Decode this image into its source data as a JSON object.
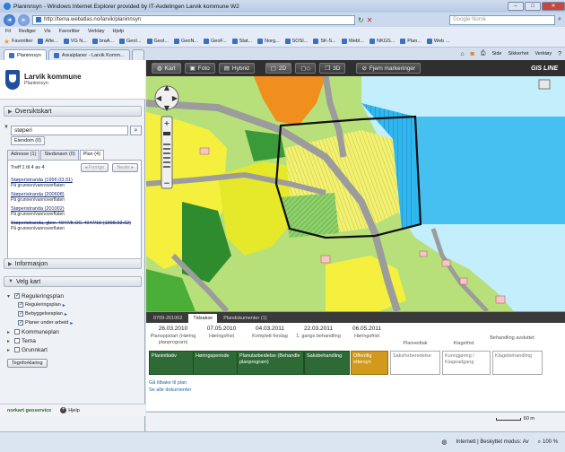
{
  "browser": {
    "title": "Planinnsyn - Windows Internet Explorer provided by IT-Avdelingen Larvik kommune W2",
    "url": "http://tema.webatlas.no/larvik/planinnsyn",
    "search_placeholder": "Google Norsk",
    "menu": [
      "Fil",
      "Rediger",
      "Vis",
      "Favoritter",
      "Verktøy",
      "Hjelp"
    ],
    "favorites_label": "Favoritter",
    "favorites": [
      "Afte...",
      "VG N...",
      "braA...",
      "GeoI...",
      "GeoI...",
      "GeoN...",
      "GeoF...",
      "Stat...",
      "Norg...",
      "SOSI...",
      "SK-S...",
      "WebI...",
      "NKGS...",
      "Plan...",
      "Web ..."
    ],
    "tabs": [
      {
        "label": "Planinnsyn",
        "active": true
      },
      {
        "label": "Arealplaner - Larvik Komm...",
        "active": false
      }
    ],
    "commands": [
      "Side",
      "Sikkerhet",
      "Verktøy"
    ],
    "status_zone": "Internett | Beskyttet modus: Av",
    "zoom": "100 %"
  },
  "app": {
    "name": "Larvik kommune",
    "subtitle": "Planinnsyn",
    "sections": {
      "overview": "Oversiktskart",
      "info": "Informasjon",
      "choose_map": "Velg kart"
    },
    "search": {
      "value": "støperi"
    },
    "owners_button": "Eiendom (0)",
    "result_tabs": [
      {
        "label": "Adresse (1)"
      },
      {
        "label": "Stedsnavn (0)"
      },
      {
        "label": "Plan (4)",
        "active": true
      }
    ],
    "paging": {
      "text": "Treff 1 til 4 av 4",
      "prev": "◂ Forrige",
      "next": "Neste ▸"
    },
    "results": [
      {
        "title": "Støperistranda (1996.03.01)",
        "sub": "På grunnen/vannoverflaten"
      },
      {
        "title": "Støperistranda (200608)",
        "sub": "På grunnen/vannoverflaten"
      },
      {
        "title": "Støperistranda (201002)",
        "sub": "På grunnen/vannoverflaten"
      },
      {
        "title": "Støperistranda, gbnr. 4047/5 OG 4047/10 (1998.03.02)",
        "sub": "På grunnen/vannoverflaten"
      }
    ],
    "layers": [
      {
        "label": "Reguleringsplan",
        "checked": true,
        "level": 0
      },
      {
        "label": "Reguleringsplan",
        "checked": true,
        "level": 1
      },
      {
        "label": "Bebyggelsesplan",
        "checked": true,
        "level": 1
      },
      {
        "label": "Planer under arbeid",
        "checked": true,
        "level": 1
      },
      {
        "label": "Kommuneplan",
        "checked": false,
        "level": 0
      },
      {
        "label": "Tema",
        "checked": false,
        "level": 0
      },
      {
        "label": "Grunnkart",
        "checked": false,
        "level": 0
      }
    ],
    "legend_button": "Tegnforklaring",
    "footer_logo": "norkart geoservice",
    "help": "Hjelp"
  },
  "map_toolbar": {
    "kart": "Kart",
    "foto": "Foto",
    "hybrid": "Hybrid",
    "d2": "2D",
    "d3": "3D",
    "clear": "Fjern markeringer",
    "brand": "GIS LINE"
  },
  "timeline": {
    "tabs": [
      "0709-201002",
      "Tidsakse",
      "Plandokumenter (1)"
    ],
    "events": [
      {
        "date": "26.03.2010",
        "label": "Planoppstart (Høring planprogram)"
      },
      {
        "date": "07.05.2010",
        "label": "Høringsfrist"
      },
      {
        "date": "04.03.2011",
        "label": "Komplett forslag"
      },
      {
        "date": "22.03.2011",
        "label": "1. gangs behandling"
      },
      {
        "date": "06.05.2011",
        "label": "Høringsfrist"
      },
      {
        "date": "",
        "label": "Planvedtak"
      },
      {
        "date": "",
        "label": "Klagefrist"
      },
      {
        "date": "",
        "label": "Behandling avsluttet"
      }
    ],
    "stages": [
      {
        "label": "Planinitiativ",
        "state": "done"
      },
      {
        "label": "Høringsperiode",
        "state": "done"
      },
      {
        "label": "Planutarbeidelse (Behandle planprogram)",
        "state": "done"
      },
      {
        "label": "Saksbehandling",
        "state": "done"
      },
      {
        "label": "Offentlig ettersyn",
        "state": "cur"
      },
      {
        "label": "Saksforberedelse",
        "state": "todo"
      },
      {
        "label": "Kunngjøring / Klageadgang",
        "state": "todo"
      },
      {
        "label": "Klagebehandling",
        "state": "todo"
      }
    ],
    "back_link": "Gå tilbake til plan",
    "all_docs": "Se alle dokumenter",
    "scale": "60 m"
  }
}
